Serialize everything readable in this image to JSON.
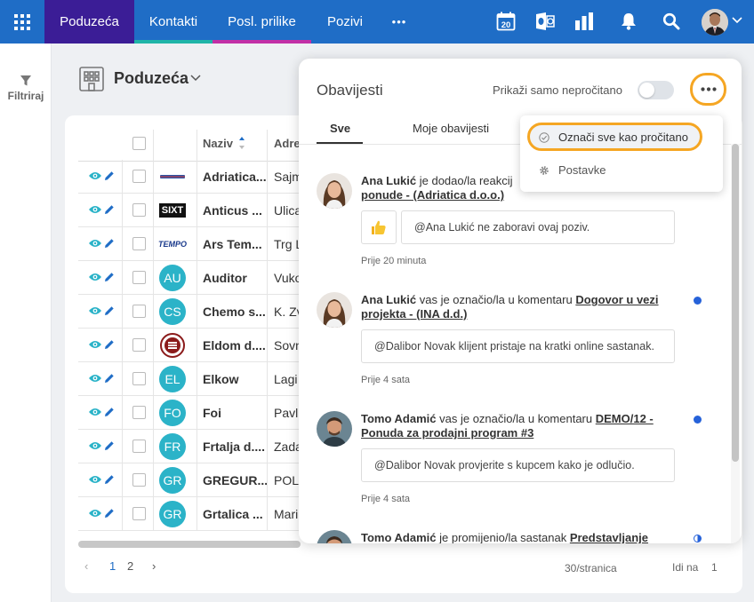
{
  "nav": {
    "tabs": [
      {
        "label": "Poduzeća"
      },
      {
        "label": "Kontakti"
      },
      {
        "label": "Posl. prilike"
      },
      {
        "label": "Pozivi"
      }
    ],
    "more_label": "•••",
    "calendar_day": "20",
    "colors": {
      "bar": "#1f6dc6",
      "active": "#3b1d96",
      "kontakti_accent": "#1fb5a8",
      "prilike_accent": "#c230a6"
    }
  },
  "left": {
    "filter_label": "Filtriraj"
  },
  "page": {
    "title": "Poduzeća"
  },
  "table": {
    "headers": {
      "naziv": "Naziv",
      "adresa": "Adre"
    },
    "rows": [
      {
        "name": "Adriatica...",
        "addr": "Sajm",
        "logo": "adriatica-logo"
      },
      {
        "name": "Anticus ...",
        "addr": "Ulica",
        "logo": "sixt-logo",
        "logo_text": "SIXT"
      },
      {
        "name": "Ars Tem...",
        "addr": "Trg L",
        "logo": "tempo-logo",
        "logo_text": "TEMPO"
      },
      {
        "name": "Auditor",
        "addr": "Vuko",
        "initials": "AU"
      },
      {
        "name": "Chemo s...",
        "addr": "K. Zv",
        "initials": "CS"
      },
      {
        "name": "Eldom d....",
        "addr": "Sovn",
        "logo": "eldom-logo"
      },
      {
        "name": "Elkow",
        "addr": "Lagi",
        "initials": "EL"
      },
      {
        "name": "Foi",
        "addr": "Pavl",
        "initials": "FO"
      },
      {
        "name": "Frtalja d....",
        "addr": "Zada",
        "initials": "FR"
      },
      {
        "name": "GREGUR...",
        "addr": "POL",
        "initials": "GR"
      },
      {
        "name": "Grtalica ...",
        "addr": "Mari",
        "initials": "GR"
      }
    ],
    "pagination": {
      "page1": "1",
      "page2": "2",
      "per_page": "30/stranica",
      "goto_label": "Idi na",
      "goto_value": "1"
    }
  },
  "panel": {
    "title": "Obavijesti",
    "unread_label": "Prikaži samo nepročitano",
    "tabs": {
      "all": "Sve",
      "mine": "Moje obavijesti"
    },
    "notifications": [
      {
        "user": "Ana Lukić",
        "action": " je dodao/la reakcij",
        "link": "ponude - (Adriatica d.o.o.)",
        "reaction": "thumbs-up",
        "comment": "@Ana Lukić ne zaboravi ovaj poziv.",
        "time": "Prije 20 minuta"
      },
      {
        "user": "Ana Lukić",
        "action": " vas je označio/la u komentaru ",
        "link1": "Dogovor u vezi",
        "link2": "projekta - (INA d.d.)",
        "comment": "@Dalibor Novak klijent pristaje na kratki online sastanak.",
        "time": "Prije 4 sata"
      },
      {
        "user": "Tomo Adamić",
        "action": " vas je označio/la u komentaru ",
        "link1": "DEMO/12 -",
        "link2": "Ponuda za prodajni program #3",
        "comment": "@Dalibor Novak provjerite s kupcem kako je odlučio.",
        "time": "Prije 4 sata"
      },
      {
        "user": "Tomo Adamić",
        "action": " je promijenio/la sastanak ",
        "link1": "Predstavljanje"
      }
    ]
  },
  "dropdown": {
    "mark_all": "Označi sve kao pročitano",
    "settings": "Postavke"
  }
}
